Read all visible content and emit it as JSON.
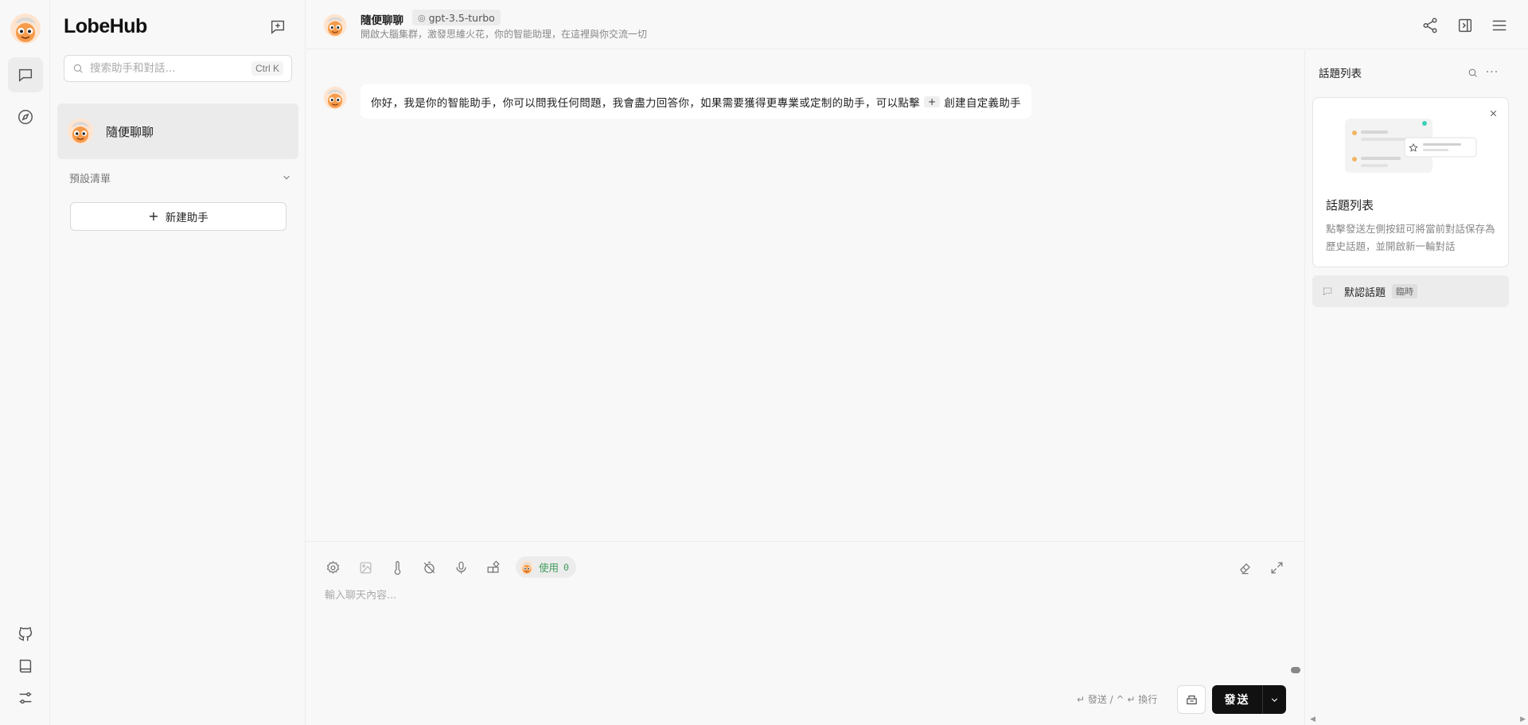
{
  "app": {
    "brand": "LobeHub"
  },
  "rail": {
    "items": [
      {
        "name": "chat",
        "icon": "chat-bubble-icon",
        "active": true
      },
      {
        "name": "discover",
        "icon": "compass-icon",
        "active": false
      }
    ],
    "bottom_items": [
      {
        "name": "github",
        "icon": "github-icon"
      },
      {
        "name": "docs",
        "icon": "book-icon"
      },
      {
        "name": "settings",
        "icon": "sliders-icon"
      }
    ]
  },
  "sidebar": {
    "search": {
      "placeholder": "搜索助手和對話...",
      "shortcut": "Ctrl K"
    },
    "sessions": [
      {
        "label": "隨便聊聊",
        "selected": true
      }
    ],
    "preset_list_label": "預設清單",
    "new_agent_label": "新建助手"
  },
  "header": {
    "title": "隨便聊聊",
    "model": "gpt-3.5-turbo",
    "description": "開啟大腦集群，激發思維火花，你的智能助理，在這裡與你交流一切"
  },
  "chat": {
    "messages": [
      {
        "role": "assistant",
        "text_before": "你好，我是你的智能助手，你可以問我任何問題，我會盡力回答你，如果需要獲得更專業或定制的助手，可以點擊",
        "key": "+",
        "text_after": "創建自定義助手"
      }
    ]
  },
  "composer": {
    "tools": [
      "gear-icon",
      "image-icon",
      "thermometer-icon",
      "timer-off-icon",
      "microphone-icon",
      "plugins-icon"
    ],
    "usage_label": "使用",
    "usage_count": "0",
    "placeholder": "輸入聊天內容...",
    "hint": "↵ 發送 / ^ ↵ 換行",
    "send_label": "發送"
  },
  "topics": {
    "title": "話題列表",
    "guide": {
      "title": "話題列表",
      "description": "點擊發送左側按鈕可將當前對話保存為歷史話題，並開啟新一輪對話"
    },
    "default_topic": {
      "label": "默認話題",
      "badge": "臨時"
    }
  },
  "colors": {
    "background": "#f8f8f8",
    "primary_button": "#111111",
    "usage_green": "#3e9b5a",
    "selected_item": "#ebebeb"
  }
}
